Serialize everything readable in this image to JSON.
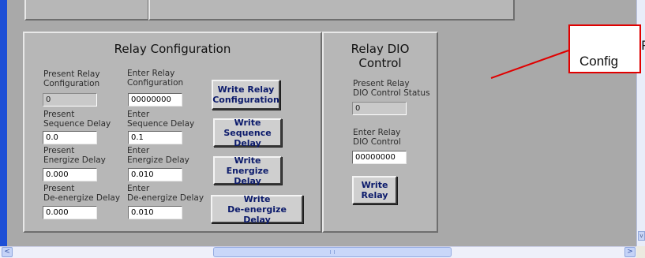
{
  "relay_configuration": {
    "title": "Relay Configuration",
    "present_config_label_1": "Present Relay",
    "present_config_label_2": "Configuration",
    "present_config_value": "0",
    "enter_config_label_1": "Enter Relay",
    "enter_config_label_2": "Configuration",
    "enter_config_value": "00000000",
    "present_seq_label_1": "Present",
    "present_seq_label_2": "Sequence Delay",
    "present_seq_value": "0.0",
    "enter_seq_label_1": "Enter",
    "enter_seq_label_2": "Sequence Delay",
    "enter_seq_value": "0.1",
    "present_energize_label_1": "Present",
    "present_energize_label_2": "Energize Delay",
    "present_energize_value": "0.000",
    "enter_energize_label_1": "Enter",
    "enter_energize_label_2": "Energize Delay",
    "enter_energize_value": "0.010",
    "present_deenergize_label_1": "Present",
    "present_deenergize_label_2": "De-energize Delay",
    "present_deenergize_value": "0.000",
    "enter_deenergize_label_1": "Enter",
    "enter_deenergize_label_2": "De-energize Delay",
    "enter_deenergize_value": "0.010",
    "write_config_button_1": "Write Relay",
    "write_config_button_2": "Configuration",
    "write_seq_button_1": "Write",
    "write_seq_button_2": "Sequence Delay",
    "write_energize_button_1": "Write",
    "write_energize_button_2": "Energize Delay",
    "write_deenergize_button_1": "Write",
    "write_deenergize_button_2": "De-energize Delay"
  },
  "relay_dio": {
    "title_1": "Relay DIO",
    "title_2": "Control",
    "present_label_1": "Present Relay",
    "present_label_2": "DIO Control Status",
    "present_value": "0",
    "enter_label_1": "Enter Relay",
    "enter_label_2": "DIO Control",
    "enter_value": "00000000",
    "write_button_1": "Write",
    "write_button_2": "Relay"
  },
  "callout": {
    "line_1": "Re",
    "line_2": "Config",
    "border_color": "#e00000"
  },
  "scrollbars": {
    "left_arrow": "<",
    "right_arrow": ">",
    "down_arrow": "v"
  },
  "colors": {
    "background": "#a9a9a9",
    "panel": "#b7b7b7",
    "window_frame": "#1d4fd6",
    "button_text": "#0b1a6b"
  }
}
